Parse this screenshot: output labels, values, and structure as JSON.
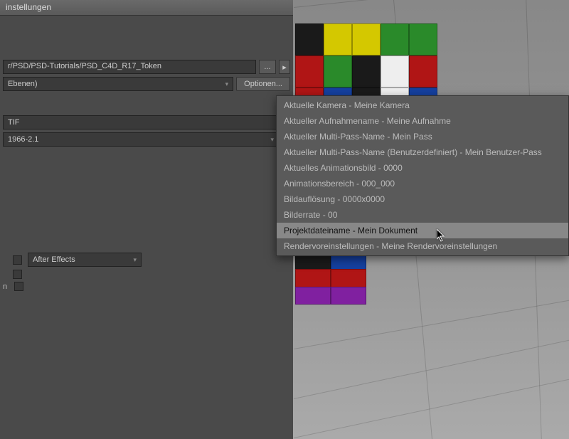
{
  "window": {
    "title": "instellungen"
  },
  "fields": {
    "path": "r/PSD/PSD-Tutorials/PSD_C4D_R17_Token",
    "layers": " Ebenen)",
    "options_btn": "Optionen...",
    "format": "TIF",
    "colorspace": "1966-2.1",
    "compositing": "After Effects",
    "browse": "...",
    "arrow": "▸"
  },
  "labels": {
    "row_n": "n"
  },
  "menu": {
    "items": [
      "Aktuelle Kamera - Meine Kamera",
      "Aktueller Aufnahmename - Meine Aufnahme",
      "Aktueller Multi-Pass-Name - Mein Pass",
      "Aktueller Multi-Pass-Name (Benutzerdefiniert) - Mein Benutzer-Pass",
      "Aktuelles Animationsbild - 0000",
      "Animationsbereich - 000_000",
      "Bildauflösung - 0000x0000",
      "Bilderrate - 00",
      "Projektdateiname - Mein Dokument",
      "Rendervoreinstellungen - Meine Rendervoreinstellungen"
    ],
    "highlighted_index": 8
  },
  "lego_colors": {
    "row0": [
      "#1a1a1a",
      "#d4c800",
      "#d4c800",
      "#2a8a2a",
      "#2a8a2a"
    ],
    "row1": [
      "#b01515",
      "#2a8a2a",
      "#1a1a1a",
      "#eee",
      "#b01515"
    ],
    "row2": [
      "#b01515",
      "#1540a0",
      "#1a1a1a",
      "#eee",
      "#1540a0"
    ],
    "row3": [
      "#b01515",
      "#1a1a1a"
    ],
    "row4": [
      "#1a1a1a",
      "#1540a0"
    ],
    "row5": [
      "#b01515",
      "#b01515"
    ],
    "row6": [
      "#8020a0",
      "#8020a0"
    ]
  }
}
